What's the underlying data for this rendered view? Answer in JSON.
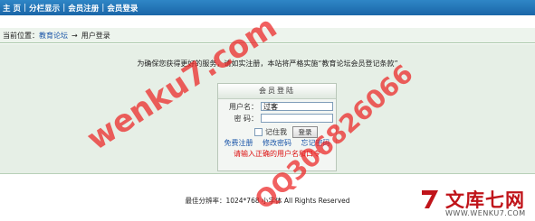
{
  "nav": {
    "items": [
      "主 页",
      "分栏显示",
      "会员注册",
      "会员登录"
    ],
    "separator": "|"
  },
  "breadcrumb": {
    "prefix": "当前位置：",
    "forum": "教育论坛",
    "arrow": "→",
    "current": "用户登录"
  },
  "notice": "为确保您获得更好的服务，请如实注册，本站将严格实施“教育论坛会员登记条款”",
  "login": {
    "title": "会员登陆",
    "username_label": "用户名：",
    "username_value": "过客",
    "password_label": "密  码：",
    "password_value": "",
    "remember_label": "记住我",
    "submit_label": "登录",
    "links": [
      "免费注册",
      "修改密码",
      "忘记密码"
    ],
    "warning": "请输入正确的用户名和口令"
  },
  "footer": "最佳分辨率：1024*768  小字体 All Rights Reserved",
  "watermark": {
    "text1": "wenku7.com",
    "text2": "QQ306826066",
    "logo_cn": "文库七网",
    "logo_url": "WWW.WENKU7.COM",
    "color": "#e62323"
  },
  "colors": {
    "nav_bg": "#1a66a8",
    "content_bg": "#e6efe6",
    "link": "#1a55a8",
    "warning": "#dd1111"
  }
}
